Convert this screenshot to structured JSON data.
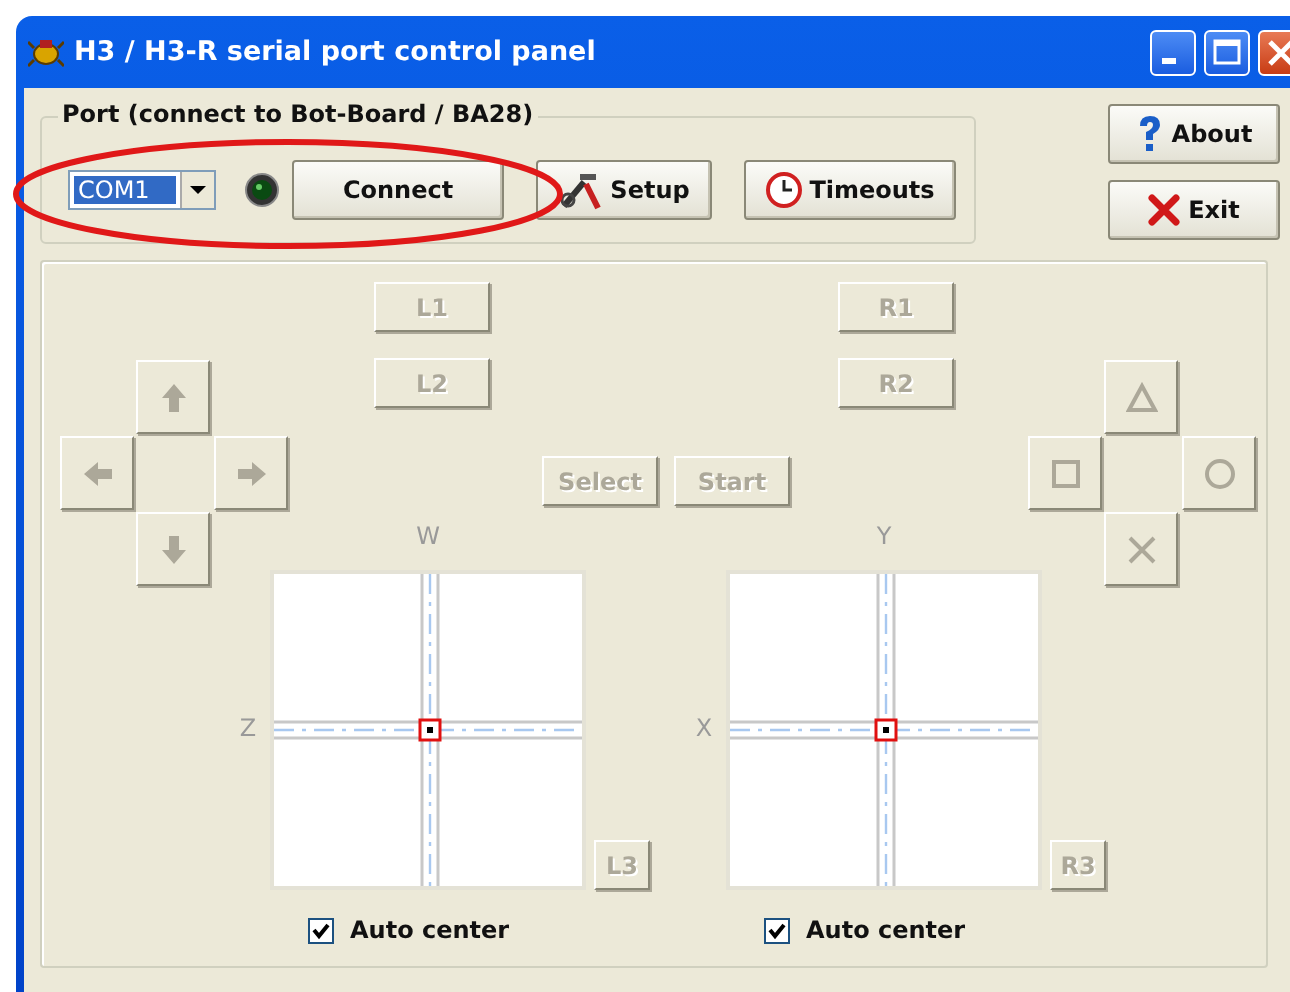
{
  "window": {
    "title": "H3 / H3-R serial port control panel"
  },
  "port_group": {
    "label": "Port (connect to Bot-Board / BA28)",
    "port_select": {
      "value": "COM1"
    },
    "connected": false,
    "buttons": [
      {
        "label": "Connect",
        "kind": "connect"
      },
      {
        "label": "Setup",
        "kind": "setup"
      },
      {
        "label": "Timeouts",
        "kind": "timeouts"
      }
    ]
  },
  "side_buttons": [
    {
      "label": "About",
      "kind": "about"
    },
    {
      "label": "Exit",
      "kind": "exit"
    }
  ],
  "controller": {
    "shoulder_buttons": [
      {
        "label": "L1",
        "disabled": true
      },
      {
        "label": "L2",
        "disabled": true
      },
      {
        "label": "R1",
        "disabled": true
      },
      {
        "label": "R2",
        "disabled": true
      },
      {
        "label": "Select",
        "disabled": true
      },
      {
        "label": "Start",
        "disabled": true
      }
    ],
    "dpad": [
      {
        "kind": "up",
        "disabled": true
      },
      {
        "kind": "left",
        "disabled": true
      },
      {
        "kind": "right",
        "disabled": true
      },
      {
        "kind": "down",
        "disabled": true
      }
    ],
    "face_buttons": [
      {
        "kind": "triangle",
        "disabled": true
      },
      {
        "kind": "square",
        "disabled": true
      },
      {
        "kind": "circle",
        "disabled": true
      },
      {
        "kind": "cross",
        "disabled": true
      }
    ],
    "sticks": [
      {
        "top_label": "W",
        "side_label": "Z",
        "button": {
          "label": "L3",
          "disabled": true
        },
        "auto_center": {
          "label": "Auto center",
          "checked": true
        }
      },
      {
        "top_label": "Y",
        "side_label": "X",
        "button": {
          "label": "R3",
          "disabled": true
        },
        "auto_center": {
          "label": "Auto center",
          "checked": true
        }
      }
    ]
  }
}
